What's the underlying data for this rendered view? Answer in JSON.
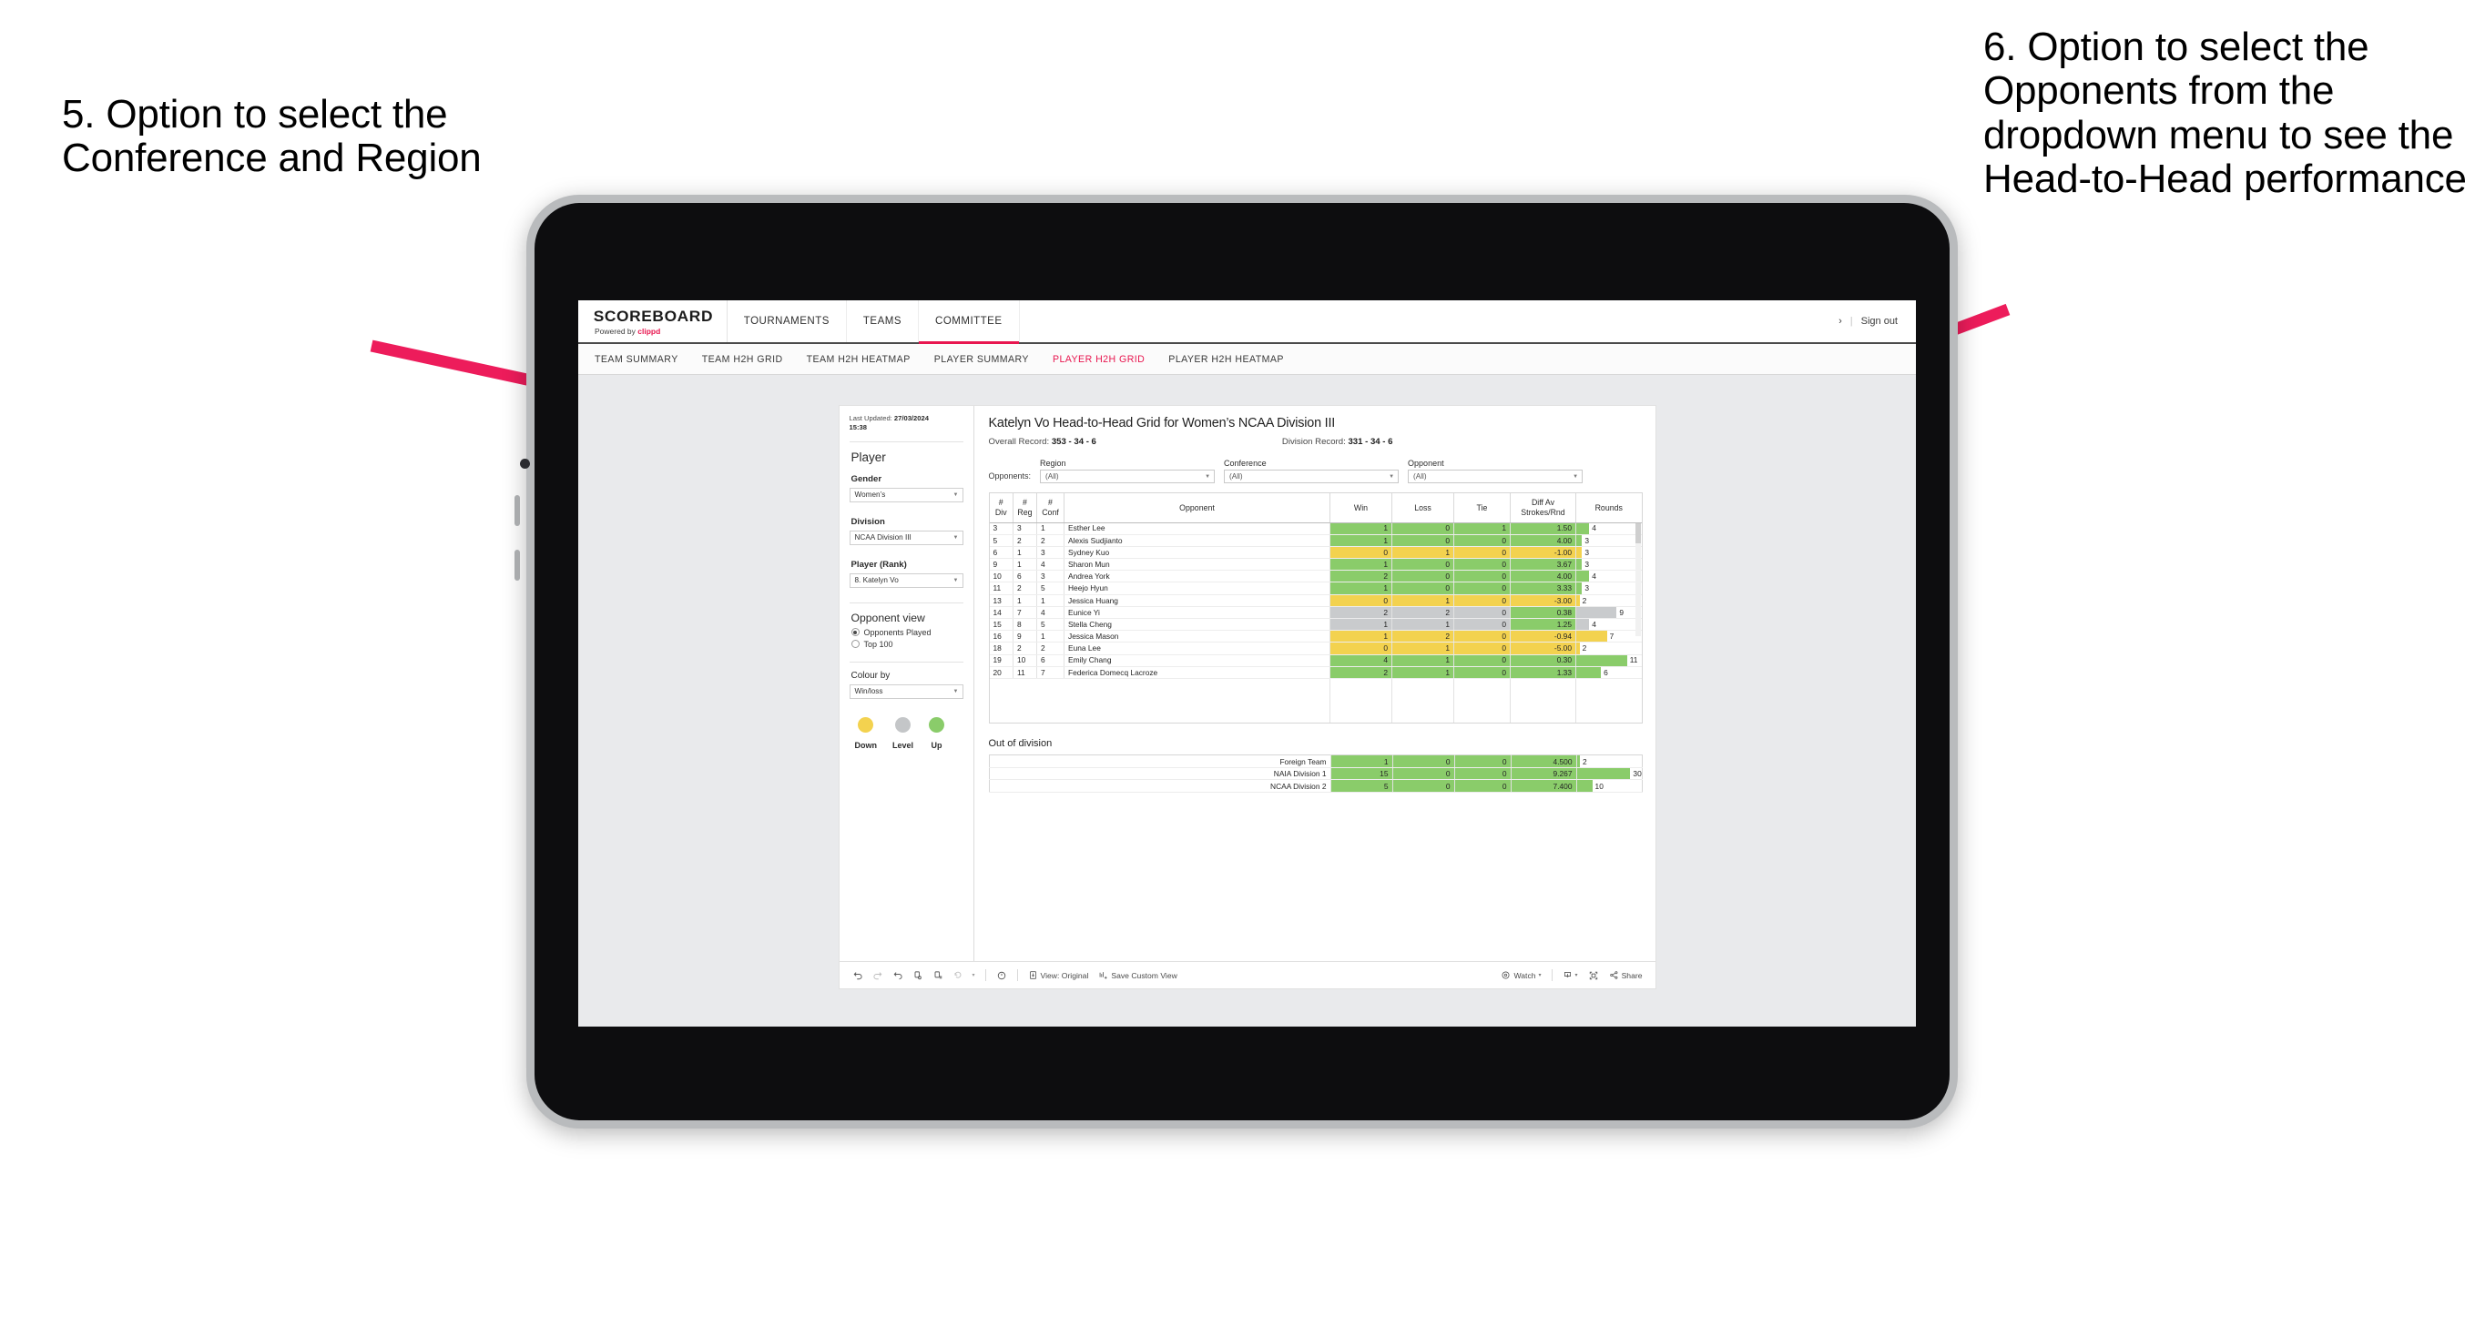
{
  "annotations": {
    "left": "5. Option to select the Conference and Region",
    "right": "6. Option to select the Opponents from the dropdown menu to see the Head-to-Head performance",
    "arrow_color": "#ED1C5B"
  },
  "app": {
    "logo": {
      "word": "SCOREBOARD",
      "powered_prefix": "Powered by ",
      "brand": "clippd"
    },
    "top_nav": [
      {
        "label": "TOURNAMENTS",
        "active": false
      },
      {
        "label": "TEAMS",
        "active": false
      },
      {
        "label": "COMMITTEE",
        "active": true
      }
    ],
    "top_right": {
      "chevron": "›",
      "separator": "|",
      "sign_out": "Sign out"
    },
    "sub_nav": [
      {
        "label": "TEAM SUMMARY",
        "active": false
      },
      {
        "label": "TEAM H2H GRID",
        "active": false
      },
      {
        "label": "TEAM H2H HEATMAP",
        "active": false
      },
      {
        "label": "PLAYER SUMMARY",
        "active": false
      },
      {
        "label": "PLAYER H2H GRID",
        "active": true
      },
      {
        "label": "PLAYER H2H HEATMAP",
        "active": false
      }
    ],
    "accent_color": "#E8164F"
  },
  "sidebar": {
    "last_updated_label": "Last Updated:",
    "last_updated_date": "27/03/2024",
    "last_updated_time": "15:38",
    "section_player": "Player",
    "gender": {
      "label": "Gender",
      "value": "Women’s"
    },
    "division": {
      "label": "Division",
      "value": "NCAA Division III"
    },
    "player_rank": {
      "label": "Player (Rank)",
      "value": "8. Katelyn Vo"
    },
    "opponent_view": {
      "label": "Opponent view",
      "options": [
        {
          "label": "Opponents Played",
          "selected": true
        },
        {
          "label": "Top 100",
          "selected": false
        }
      ]
    },
    "colour_by": {
      "label": "Colour by",
      "value": "Win/loss"
    },
    "legend": [
      {
        "label": "Down",
        "color": "#F3D24F"
      },
      {
        "label": "Level",
        "color": "#C4C6C8"
      },
      {
        "label": "Up",
        "color": "#8ACC6A"
      }
    ]
  },
  "main": {
    "title": "Katelyn Vo Head-to-Head Grid for Women’s NCAA Division III",
    "overall_record_label": "Overall Record:",
    "overall_record_value": "353 -  34 - 6",
    "division_record_label": "Division Record:",
    "division_record_value": "331 -  34 - 6",
    "opponents_label": "Opponents:",
    "filters": [
      {
        "label": "Region",
        "value": "(All)"
      },
      {
        "label": "Conference",
        "value": "(All)"
      },
      {
        "label": "Opponent",
        "value": "(All)"
      }
    ],
    "grid_headers": [
      "#\nDiv",
      "#\nReg",
      "#\nConf",
      "Opponent",
      "Win",
      "Loss",
      "Tie",
      "Diff Av\nStrokes/Rnd",
      "Rounds"
    ],
    "grid_rows": [
      {
        "div": "3",
        "reg": "3",
        "conf": "1",
        "opponent": "Esther Lee",
        "win": "1",
        "loss": "0",
        "tie": "1",
        "diff": "1.50",
        "rounds": "4",
        "state": "up",
        "bar_pct": 20
      },
      {
        "div": "5",
        "reg": "2",
        "conf": "2",
        "opponent": "Alexis Sudjianto",
        "win": "1",
        "loss": "0",
        "tie": "0",
        "diff": "4.00",
        "rounds": "3",
        "state": "up",
        "bar_pct": 9
      },
      {
        "div": "6",
        "reg": "1",
        "conf": "3",
        "opponent": "Sydney Kuo",
        "win": "0",
        "loss": "1",
        "tie": "0",
        "diff": "-1.00",
        "rounds": "3",
        "state": "down",
        "bar_pct": 9
      },
      {
        "div": "9",
        "reg": "1",
        "conf": "4",
        "opponent": "Sharon Mun",
        "win": "1",
        "loss": "0",
        "tie": "0",
        "diff": "3.67",
        "rounds": "3",
        "state": "up",
        "bar_pct": 9
      },
      {
        "div": "10",
        "reg": "6",
        "conf": "3",
        "opponent": "Andrea York",
        "win": "2",
        "loss": "0",
        "tie": "0",
        "diff": "4.00",
        "rounds": "4",
        "state": "up",
        "bar_pct": 20
      },
      {
        "div": "11",
        "reg": "2",
        "conf": "5",
        "opponent": "Heejo Hyun",
        "win": "1",
        "loss": "0",
        "tie": "0",
        "diff": "3.33",
        "rounds": "3",
        "state": "up",
        "bar_pct": 9
      },
      {
        "div": "13",
        "reg": "1",
        "conf": "1",
        "opponent": "Jessica Huang",
        "win": "0",
        "loss": "1",
        "tie": "0",
        "diff": "-3.00",
        "rounds": "2",
        "state": "down",
        "bar_pct": 5
      },
      {
        "div": "14",
        "reg": "7",
        "conf": "4",
        "opponent": "Eunice Yi",
        "win": "2",
        "loss": "2",
        "tie": "0",
        "diff": "0.38",
        "rounds": "9",
        "state": "level",
        "bar_pct": 62
      },
      {
        "div": "15",
        "reg": "8",
        "conf": "5",
        "opponent": "Stella Cheng",
        "win": "1",
        "loss": "1",
        "tie": "0",
        "diff": "1.25",
        "rounds": "4",
        "state": "level",
        "bar_pct": 20
      },
      {
        "div": "16",
        "reg": "9",
        "conf": "1",
        "opponent": "Jessica Mason",
        "win": "1",
        "loss": "2",
        "tie": "0",
        "diff": "-0.94",
        "rounds": "7",
        "state": "down",
        "bar_pct": 47
      },
      {
        "div": "18",
        "reg": "2",
        "conf": "2",
        "opponent": "Euna Lee",
        "win": "0",
        "loss": "1",
        "tie": "0",
        "diff": "-5.00",
        "rounds": "2",
        "state": "down",
        "bar_pct": 5
      },
      {
        "div": "19",
        "reg": "10",
        "conf": "6",
        "opponent": "Emily Chang",
        "win": "4",
        "loss": "1",
        "tie": "0",
        "diff": "0.30",
        "rounds": "11",
        "state": "up",
        "bar_pct": 78
      },
      {
        "div": "20",
        "reg": "11",
        "conf": "7",
        "opponent": "Federica Domecq Lacroze",
        "win": "2",
        "loss": "1",
        "tie": "0",
        "diff": "1.33",
        "rounds": "6",
        "state": "up",
        "bar_pct": 38
      }
    ],
    "out_of_division_title": "Out of division",
    "out_of_division_rows": [
      {
        "label": "Foreign Team",
        "win": "1",
        "loss": "0",
        "tie": "0",
        "diff": "4.500",
        "rounds": "2",
        "state": "up",
        "bar_pct": 5
      },
      {
        "label": "NAIA Division 1",
        "win": "15",
        "loss": "0",
        "tie": "0",
        "diff": "9.267",
        "rounds": "30",
        "state": "up",
        "bar_pct": 83
      },
      {
        "label": "NCAA Division 2",
        "win": "5",
        "loss": "0",
        "tie": "0",
        "diff": "7.400",
        "rounds": "10",
        "state": "up",
        "bar_pct": 24
      }
    ]
  },
  "toolbar": {
    "view_label": "View: Original",
    "save_label": "Save Custom View",
    "watch_label": "Watch",
    "share_label": "Share",
    "caret": "▾"
  },
  "colors": {
    "up": "#8ACC6A",
    "down": "#F3D24F",
    "level": "#C9CBCD",
    "grid_text": "#262626"
  }
}
